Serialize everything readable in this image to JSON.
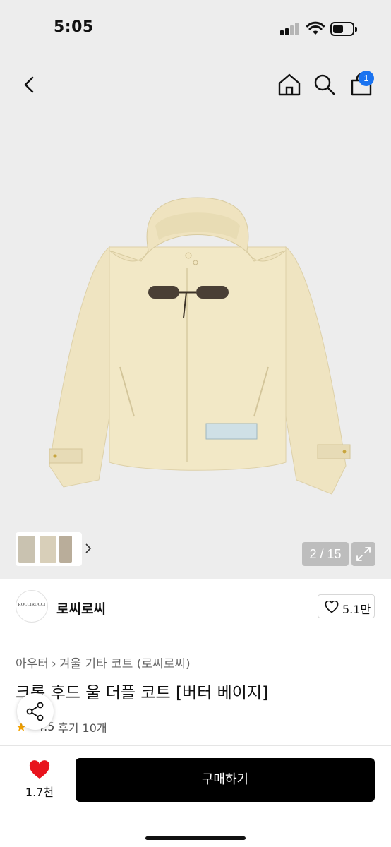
{
  "status_bar": {
    "time": "5:05"
  },
  "header": {
    "cart_badge": "1"
  },
  "gallery": {
    "counter": "2 / 15"
  },
  "brand": {
    "logo_text": "ROCCIROCCI",
    "name": "로씨로씨",
    "likes": "5.1만"
  },
  "product": {
    "breadcrumb": [
      "아우터",
      "겨울 기타 코트 (로씨로씨)"
    ],
    "title": "크롭 후드 울 더플 코트 [버터 베이지]",
    "rating": "4.5",
    "reviews": "후기 10개"
  },
  "bottom_bar": {
    "wish_count": "1.7천",
    "buy_label": "구매하기"
  },
  "colors": {
    "accent": "#1a73f0",
    "heart": "#e8131d",
    "coat": "#f2e8c6",
    "toggle": "#4a3f35",
    "star": "#f5a300"
  }
}
